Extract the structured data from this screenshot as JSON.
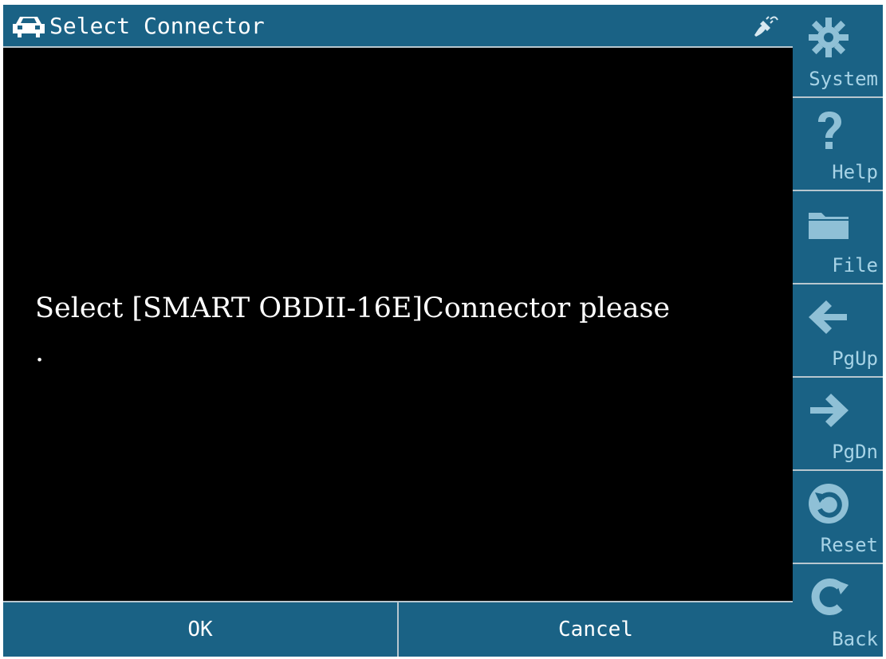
{
  "title": {
    "text": "Select Connector",
    "icon": "car-icon",
    "status_icon": "plug-icon"
  },
  "message": "Select [SMART OBDII-16E]Connector please\n.",
  "bottom_buttons": {
    "ok": "OK",
    "cancel": "Cancel"
  },
  "sidebar": {
    "system": "System",
    "help": "Help",
    "file": "File",
    "pgup": "PgUp",
    "pgdn": "PgDn",
    "reset": "Reset",
    "back": "Back"
  },
  "colors": {
    "bar": "#1a6285",
    "content": "#000000",
    "side_icon": "#8fc0d6"
  }
}
